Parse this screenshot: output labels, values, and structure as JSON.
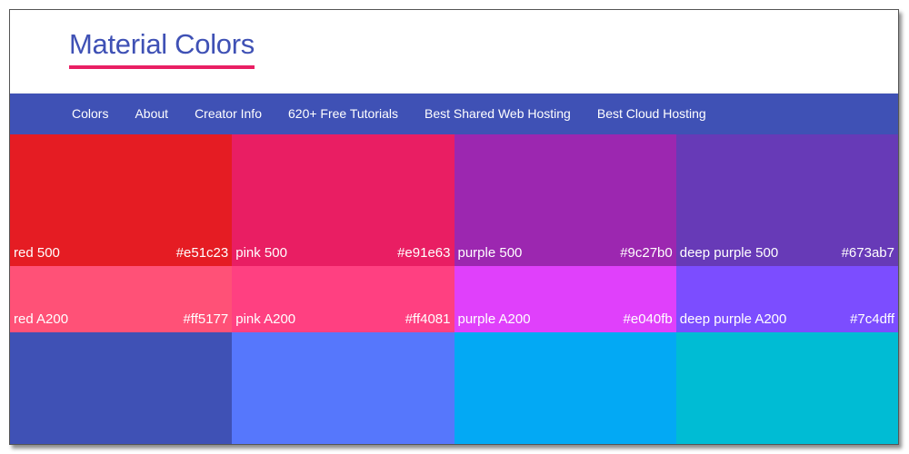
{
  "header": {
    "title": "Material Colors"
  },
  "nav": {
    "items": [
      "Colors",
      "About",
      "Creator Info",
      "620+ Free Tutorials",
      "Best Shared Web Hosting",
      "Best Cloud Hosting"
    ]
  },
  "swatches": [
    {
      "name": "red 500",
      "hex": "#e51c23",
      "color": "#e51c23"
    },
    {
      "name": "pink 500",
      "hex": "#e91e63",
      "color": "#e91e63"
    },
    {
      "name": "purple 500",
      "hex": "#9c27b0",
      "color": "#9c27b0"
    },
    {
      "name": "deep purple 500",
      "hex": "#673ab7",
      "color": "#673ab7"
    },
    {
      "name": "red A200",
      "hex": "#ff5177",
      "color": "#ff5177"
    },
    {
      "name": "pink A200",
      "hex": "#ff4081",
      "color": "#ff4081"
    },
    {
      "name": "purple A200",
      "hex": "#e040fb",
      "color": "#e040fb"
    },
    {
      "name": "deep purple A200",
      "hex": "#7c4dff",
      "color": "#7c4dff"
    },
    {
      "name": "",
      "hex": "",
      "color": "#3f51b5"
    },
    {
      "name": "",
      "hex": "",
      "color": "#5677fc"
    },
    {
      "name": "",
      "hex": "",
      "color": "#03a9f4"
    },
    {
      "name": "",
      "hex": "",
      "color": "#00bcd4"
    }
  ],
  "colors": {
    "nav_bg": "#3f51b5",
    "title": "#3f51b5",
    "title_underline": "#e91e63"
  }
}
